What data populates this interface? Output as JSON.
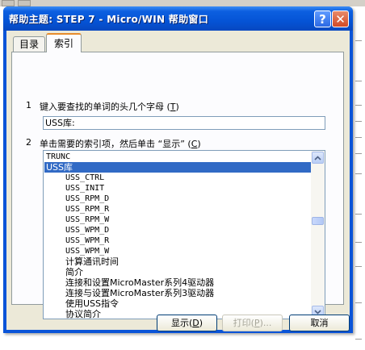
{
  "window": {
    "title": "帮助主题: STEP 7 - Micro/WIN 帮助窗口",
    "help_button": "?",
    "close_button": "✕"
  },
  "tabs": [
    {
      "label": "目录"
    },
    {
      "label": "索引"
    }
  ],
  "step1": {
    "number": "1",
    "label": "键入要查找的单词的头几个字母",
    "accel": "T"
  },
  "search": {
    "value": "USS库:"
  },
  "step2": {
    "number": "2",
    "label": "单击需要的索引项，然后单击 “显示”",
    "accel": "C"
  },
  "index_list": {
    "items": [
      {
        "text": "TRUNC",
        "level": 0,
        "selected": false
      },
      {
        "text": "USS库",
        "level": 0,
        "selected": true
      },
      {
        "text": "USS_CTRL",
        "level": 1,
        "selected": false
      },
      {
        "text": "USS_INIT",
        "level": 1,
        "selected": false
      },
      {
        "text": "USS_RPM_D",
        "level": 1,
        "selected": false
      },
      {
        "text": "USS_RPM_R",
        "level": 1,
        "selected": false
      },
      {
        "text": "USS_RPM_W",
        "level": 1,
        "selected": false
      },
      {
        "text": "USS_WPM_D",
        "level": 1,
        "selected": false
      },
      {
        "text": "USS_WPM_R",
        "level": 1,
        "selected": false
      },
      {
        "text": "USS_WPM_W",
        "level": 1,
        "selected": false
      },
      {
        "text": "计算通讯时间",
        "level": 1,
        "selected": false
      },
      {
        "text": "简介",
        "level": 1,
        "selected": false
      },
      {
        "text": "连接和设置MicroMaster系列4驱动器",
        "level": 1,
        "selected": false
      },
      {
        "text": "连接与设置MicroMaster系列3驱动器",
        "level": 1,
        "selected": false
      },
      {
        "text": "使用USS指令",
        "level": 1,
        "selected": false
      },
      {
        "text": "协议简介",
        "level": 1,
        "selected": false
      }
    ]
  },
  "buttons": {
    "show": {
      "label": "显示",
      "accel": "D",
      "suffix": ""
    },
    "print": {
      "label": "打印",
      "accel": "P",
      "suffix": "..."
    },
    "cancel": {
      "label": "取消"
    }
  }
}
